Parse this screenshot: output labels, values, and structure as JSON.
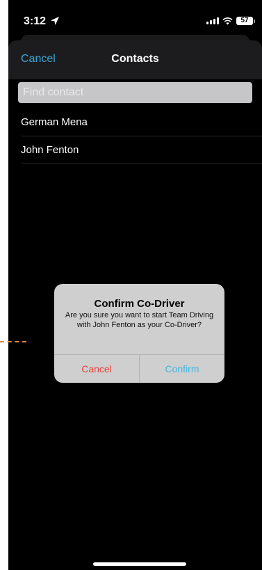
{
  "status_bar": {
    "time": "3:12",
    "battery": "57",
    "icons": [
      "location-arrow-icon",
      "signal-icon",
      "wifi-icon",
      "battery-icon"
    ]
  },
  "nav": {
    "cancel_label": "Cancel",
    "title": "Contacts"
  },
  "search": {
    "placeholder": "Find contact",
    "value": ""
  },
  "contacts": [
    {
      "name": "German Mena"
    },
    {
      "name": "John Fenton"
    }
  ],
  "alert": {
    "title": "Confirm Co-Driver",
    "message": "Are you sure you want to start Team Driving with John Fenton as your Co-Driver?",
    "cancel_label": "Cancel",
    "confirm_label": "Confirm"
  },
  "colors": {
    "accent": "#3aa6d8",
    "destructive": "#e5453b",
    "annotation": "#e8853a"
  }
}
